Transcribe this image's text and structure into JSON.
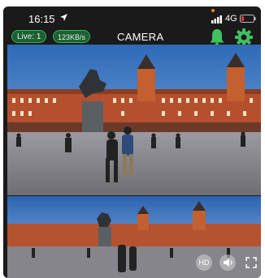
{
  "status_bar": {
    "time": "16:15",
    "network": "4G",
    "location_icon": "location-arrow-icon",
    "signal_icon": "signal-bars-icon",
    "battery_icon": "battery-low-icon"
  },
  "header": {
    "live_label": "Live: 1",
    "speed_label": "123KB/s",
    "title": "CAMERA",
    "bell_icon": "bell-icon",
    "settings_icon": "gear-icon"
  },
  "controls": {
    "hd_label": "HD",
    "sound_icon": "speaker-icon",
    "fullscreen_icon": "fullscreen-icon"
  },
  "colors": {
    "background": "#1a1a1a",
    "accent": "#2fb35a",
    "pill_bg": "#1f5f34",
    "battery_low": "#e53935",
    "dot": "#f08a24"
  }
}
